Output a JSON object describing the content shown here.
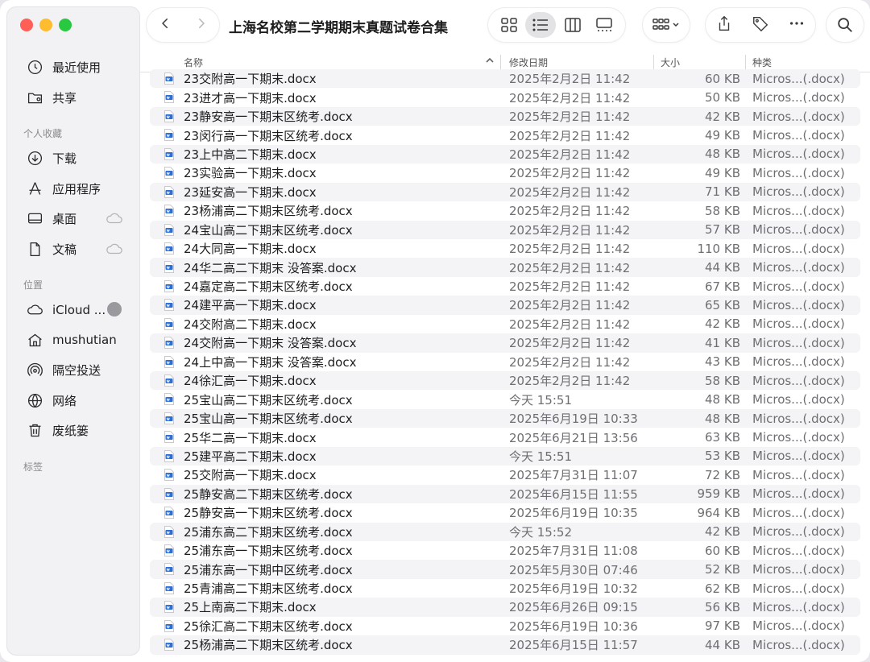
{
  "window": {
    "title": "上海名校第二学期期末真题试卷合集"
  },
  "sidebar": {
    "favorites": [
      {
        "label": "最近使用",
        "icon": "clock-icon"
      },
      {
        "label": "共享",
        "icon": "shared-folder-icon"
      }
    ],
    "section_personal": "个人收藏",
    "personal": [
      {
        "label": "下载",
        "icon": "download-icon"
      },
      {
        "label": "应用程序",
        "icon": "applications-icon"
      },
      {
        "label": "桌面",
        "icon": "desktop-icon",
        "cloud": true
      },
      {
        "label": "文稿",
        "icon": "document-icon",
        "cloud": true
      }
    ],
    "section_locations": "位置",
    "locations": [
      {
        "label": "iCloud ...",
        "icon": "icloud-icon"
      },
      {
        "label": "mushutian",
        "icon": "home-icon"
      },
      {
        "label": "隔空投送",
        "icon": "airdrop-icon"
      },
      {
        "label": "网络",
        "icon": "network-icon"
      },
      {
        "label": "废纸篓",
        "icon": "trash-icon"
      }
    ],
    "section_tags": "标签"
  },
  "columns": {
    "name": "名称",
    "date": "修改日期",
    "size": "大小",
    "kind": "种类"
  },
  "files": [
    {
      "name": "23交附高一下期末.docx",
      "date": "2025年2月2日 11:42",
      "size": "60 KB",
      "kind": "Micros...(.docx)"
    },
    {
      "name": "23进才高一下期末.docx",
      "date": "2025年2月2日 11:42",
      "size": "50 KB",
      "kind": "Micros...(.docx)"
    },
    {
      "name": "23静安高一下期末区统考.docx",
      "date": "2025年2月2日 11:42",
      "size": "42 KB",
      "kind": "Micros...(.docx)"
    },
    {
      "name": "23闵行高一下期末区统考.docx",
      "date": "2025年2月2日 11:42",
      "size": "49 KB",
      "kind": "Micros...(.docx)"
    },
    {
      "name": "23上中高二下期末.docx",
      "date": "2025年2月2日 11:42",
      "size": "48 KB",
      "kind": "Micros...(.docx)"
    },
    {
      "name": "23实验高一下期末.docx",
      "date": "2025年2月2日 11:42",
      "size": "49 KB",
      "kind": "Micros...(.docx)"
    },
    {
      "name": "23延安高一下期末.docx",
      "date": "2025年2月2日 11:42",
      "size": "71 KB",
      "kind": "Micros...(.docx)"
    },
    {
      "name": "23杨浦高二下期末区统考.docx",
      "date": "2025年2月2日 11:42",
      "size": "58 KB",
      "kind": "Micros...(.docx)"
    },
    {
      "name": "24宝山高二下期末区统考.docx",
      "date": "2025年2月2日 11:42",
      "size": "57 KB",
      "kind": "Micros...(.docx)"
    },
    {
      "name": "24大同高一下期末.docx",
      "date": "2025年2月2日 11:42",
      "size": "110 KB",
      "kind": "Micros...(.docx)"
    },
    {
      "name": "24华二高二下期末 没答案.docx",
      "date": "2025年2月2日 11:42",
      "size": "44 KB",
      "kind": "Micros...(.docx)"
    },
    {
      "name": "24嘉定高二下期末区统考.docx",
      "date": "2025年2月2日 11:42",
      "size": "67 KB",
      "kind": "Micros...(.docx)"
    },
    {
      "name": "24建平高一下期末.docx",
      "date": "2025年2月2日 11:42",
      "size": "65 KB",
      "kind": "Micros...(.docx)"
    },
    {
      "name": "24交附高二下期末.docx",
      "date": "2025年2月2日 11:42",
      "size": "42 KB",
      "kind": "Micros...(.docx)"
    },
    {
      "name": "24交附高一下期末 没答案.docx",
      "date": "2025年2月2日 11:42",
      "size": "41 KB",
      "kind": "Micros...(.docx)"
    },
    {
      "name": "24上中高一下期末 没答案.docx",
      "date": "2025年2月2日 11:42",
      "size": "43 KB",
      "kind": "Micros...(.docx)"
    },
    {
      "name": "24徐汇高一下期末.docx",
      "date": "2025年2月2日 11:42",
      "size": "58 KB",
      "kind": "Micros...(.docx)"
    },
    {
      "name": "25宝山高二下期末区统考.docx",
      "date": "今天 15:51",
      "size": "48 KB",
      "kind": "Micros...(.docx)"
    },
    {
      "name": "25宝山高一下期末区统考.docx",
      "date": "2025年6月19日 10:33",
      "size": "48 KB",
      "kind": "Micros...(.docx)"
    },
    {
      "name": "25华二高一下期末.docx",
      "date": "2025年6月21日 13:56",
      "size": "63 KB",
      "kind": "Micros...(.docx)"
    },
    {
      "name": "25建平高二下期末.docx",
      "date": "今天 15:51",
      "size": "53 KB",
      "kind": "Micros...(.docx)"
    },
    {
      "name": "25交附高一下期末.docx",
      "date": "2025年7月31日 11:07",
      "size": "72 KB",
      "kind": "Micros...(.docx)"
    },
    {
      "name": "25静安高二下期末区统考.docx",
      "date": "2025年6月15日 11:55",
      "size": "959 KB",
      "kind": "Micros...(.docx)"
    },
    {
      "name": "25静安高一下期末区统考.docx",
      "date": "2025年6月19日 10:35",
      "size": "964 KB",
      "kind": "Micros...(.docx)"
    },
    {
      "name": "25浦东高二下期末区统考.docx",
      "date": "今天 15:52",
      "size": "42 KB",
      "kind": "Micros...(.docx)"
    },
    {
      "name": "25浦东高一下期末区统考.docx",
      "date": "2025年7月31日 11:08",
      "size": "60 KB",
      "kind": "Micros...(.docx)"
    },
    {
      "name": "25浦东高一下期中区统考.docx",
      "date": "2025年5月30日 07:46",
      "size": "52 KB",
      "kind": "Micros...(.docx)"
    },
    {
      "name": "25青浦高二下期末区统考.docx",
      "date": "2025年6月19日 10:32",
      "size": "62 KB",
      "kind": "Micros...(.docx)"
    },
    {
      "name": "25上南高二下期末.docx",
      "date": "2025年6月26日 09:15",
      "size": "56 KB",
      "kind": "Micros...(.docx)"
    },
    {
      "name": "25徐汇高二下期末区统考.docx",
      "date": "2025年6月19日 10:36",
      "size": "97 KB",
      "kind": "Micros...(.docx)"
    },
    {
      "name": "25杨浦高二下期末区统考.docx",
      "date": "2025年6月15日 11:57",
      "size": "44 KB",
      "kind": "Micros...(.docx)"
    }
  ],
  "colors": {
    "file_icon_blue": "#2b6fd6",
    "close": "#ff5f57",
    "minimize": "#febc2e",
    "maximize": "#28c840"
  }
}
